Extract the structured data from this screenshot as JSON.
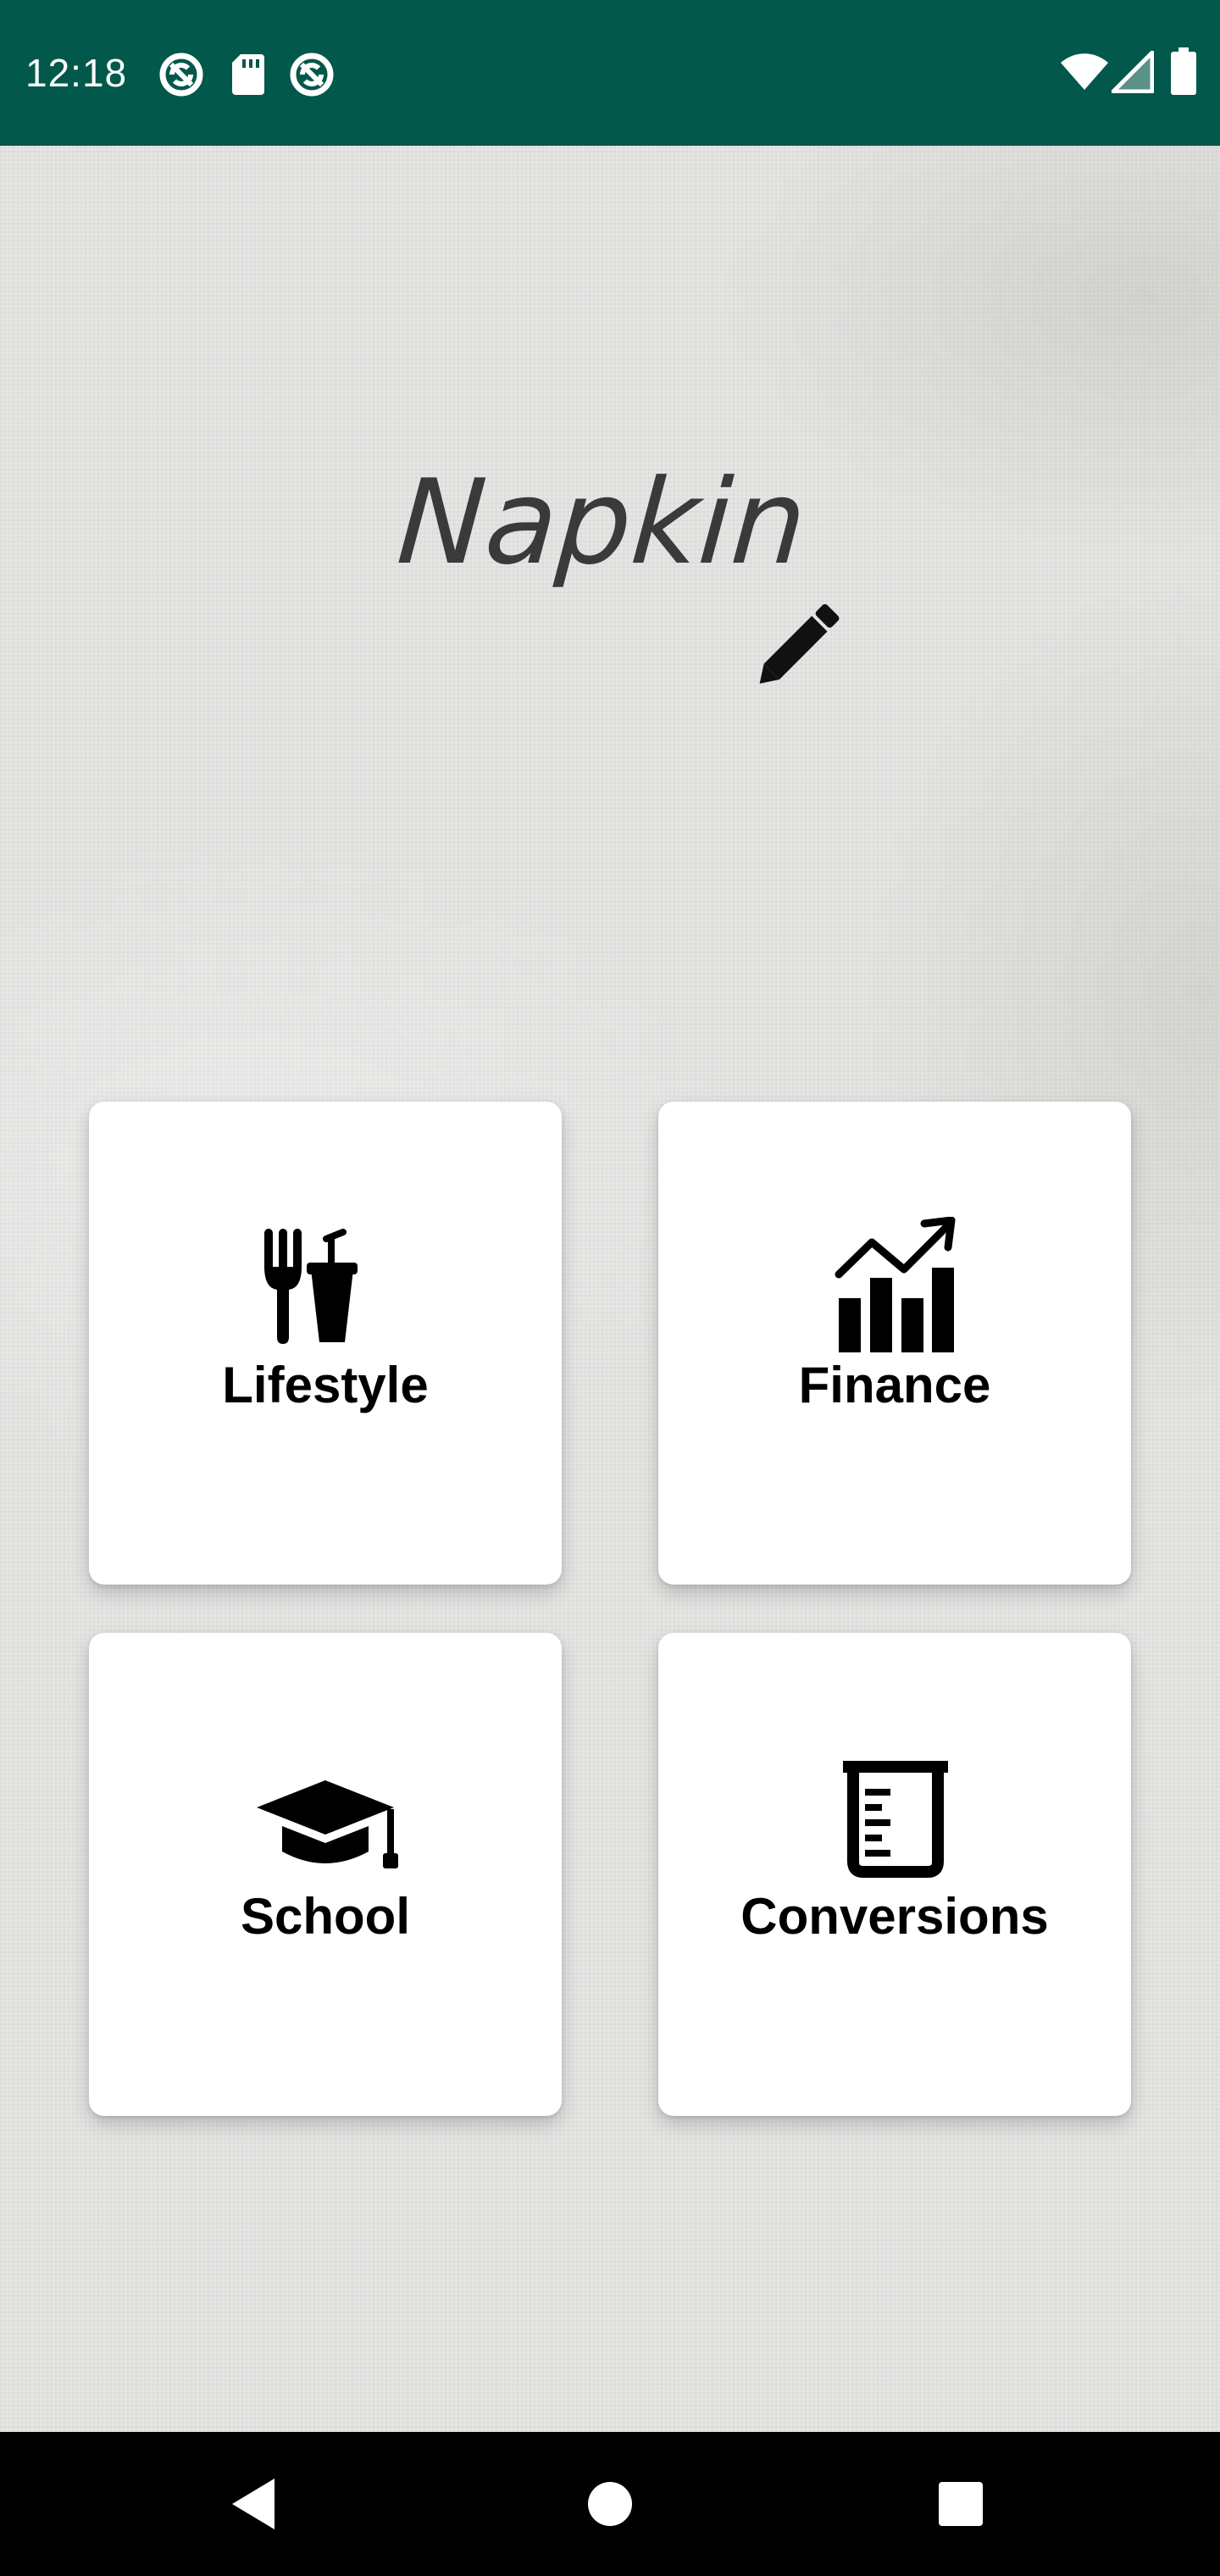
{
  "status_bar": {
    "time": "12:18",
    "background": "#02584b",
    "left_icons": [
      "sync-icon",
      "sd-card-icon",
      "sync-icon"
    ],
    "right_icons": [
      "wifi-icon",
      "cell-signal-icon",
      "battery-icon"
    ]
  },
  "app": {
    "logo_text": "Napkin",
    "logo_icon": "pencil-icon"
  },
  "categories": [
    {
      "label": "Lifestyle",
      "icon": "utensils-drink-icon"
    },
    {
      "label": "Finance",
      "icon": "chart-growth-icon"
    },
    {
      "label": "School",
      "icon": "graduation-cap-icon"
    },
    {
      "label": "Conversions",
      "icon": "beaker-icon"
    }
  ],
  "nav_bar": {
    "buttons": [
      "back-icon",
      "home-icon",
      "recents-icon"
    ]
  }
}
